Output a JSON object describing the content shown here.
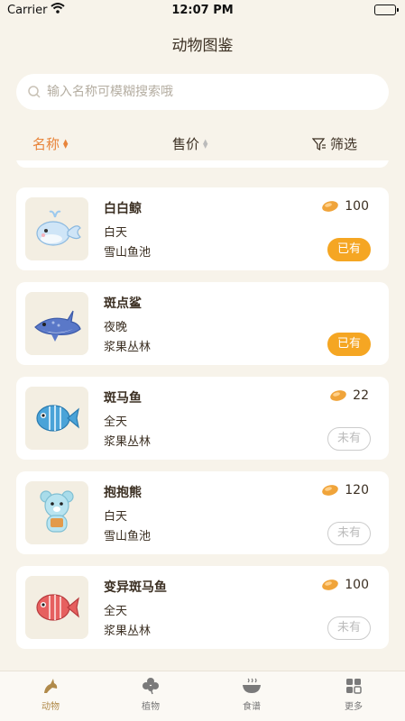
{
  "status_bar": {
    "carrier": "Carrier",
    "time": "12:07 PM"
  },
  "nav": {
    "title": "动物图鉴"
  },
  "search": {
    "placeholder": "输入名称可模糊搜索哦",
    "value": ""
  },
  "sort": {
    "name_label": "名称",
    "price_label": "售价",
    "filter_label": "筛选",
    "active_sort": "名称"
  },
  "animals": [
    {
      "name": "白白鲸",
      "time": "白天",
      "place": "雪山鱼池",
      "price": "100",
      "status": "已有",
      "owned": true,
      "icon": "whale-icon"
    },
    {
      "name": "斑点鲨",
      "time": "夜晚",
      "place": "浆果丛林",
      "price": "",
      "status": "已有",
      "owned": true,
      "icon": "shark-icon"
    },
    {
      "name": "斑马鱼",
      "time": "全天",
      "place": "浆果丛林",
      "price": "22",
      "status": "未有",
      "owned": false,
      "icon": "zebrafish-icon"
    },
    {
      "name": "抱抱熊",
      "time": "白天",
      "place": "雪山鱼池",
      "price": "120",
      "status": "未有",
      "owned": false,
      "icon": "bear-icon"
    },
    {
      "name": "变异斑马鱼",
      "time": "全天",
      "place": "浆果丛林",
      "price": "100",
      "status": "未有",
      "owned": false,
      "icon": "mutant-zebrafish-icon"
    }
  ],
  "tabs": [
    {
      "label": "动物",
      "icon": "animal-icon",
      "active": true
    },
    {
      "label": "植物",
      "icon": "clover-icon",
      "active": false
    },
    {
      "label": "食谱",
      "icon": "bowl-icon",
      "active": false
    },
    {
      "label": "更多",
      "icon": "grid-icon",
      "active": false
    }
  ],
  "colors": {
    "accent": "#e8843a",
    "owned": "#f5a623",
    "background": "#f7f3ea"
  }
}
